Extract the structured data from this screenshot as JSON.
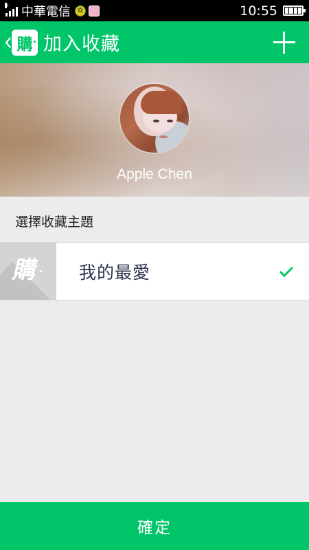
{
  "status_bar": {
    "carrier": "中華電信",
    "signal_label": "H",
    "time": "10:55",
    "icons": [
      "signal-icon",
      "app-notification-icon",
      "message-notification-icon",
      "battery-icon"
    ]
  },
  "app_bar": {
    "back_icon": "chevron-left-icon",
    "logo_text": "購",
    "title": "加入收藏",
    "add_icon": "plus-icon"
  },
  "profile": {
    "name": "Apple Chen"
  },
  "collections": {
    "section_label": "選擇收藏主題",
    "items": [
      {
        "thumb_text": "購",
        "label": "我的最愛",
        "selected": true
      }
    ]
  },
  "footer": {
    "confirm_label": "確定"
  },
  "colors": {
    "brand_green": "#00c569",
    "background": "#ececec",
    "item_text": "#2b3450"
  }
}
